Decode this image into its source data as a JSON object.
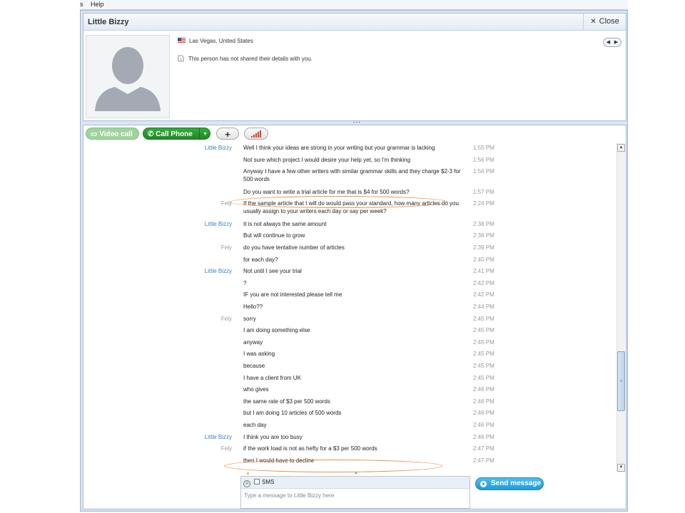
{
  "menu": {
    "partial_item": "s",
    "help": "Help"
  },
  "profile": {
    "name": "Little Bizzy",
    "close_label": "Close",
    "location": "Las Vegas, United States",
    "notice": "This person has not shared their details with you."
  },
  "toolbar": {
    "video_label": "Video call",
    "call_label": "Call Phone",
    "add_label": "+"
  },
  "messages": [
    {
      "sender": "Little Bizzy",
      "text": "Well I think your ideas are strong in your writing but your grammar is lacking",
      "time": "1:55 PM"
    },
    {
      "sender": "",
      "text": "Not sure which project I would desire your help yet, so I'm thinking",
      "time": "1:56 PM"
    },
    {
      "sender": "",
      "text": "Anyway I have a few other writers with similar grammar skills and they charge $2-3 for 500 words",
      "time": "1:56 PM"
    },
    {
      "sender": "",
      "text": "Do you want to write a trial article for me that is $4 for 500 words?",
      "time": "1:57 PM"
    },
    {
      "sender": "Fely",
      "text": "If the sample article that I will do would pass your standard, how many articles do you usually assign to your writers each day or say per week?",
      "time": "2:24 PM"
    },
    {
      "sender": "Little Bizzy",
      "text": "It is not always the same amount",
      "time": "2:38 PM"
    },
    {
      "sender": "",
      "text": "But will continue to grow",
      "time": "2:38 PM"
    },
    {
      "sender": "Fely",
      "text": "do you have tentative number of articles",
      "time": "2:39 PM"
    },
    {
      "sender": "",
      "text": "for each day?",
      "time": "2:40 PM"
    },
    {
      "sender": "Little Bizzy",
      "text": "Not until I see your trial",
      "time": "2:41 PM"
    },
    {
      "sender": "",
      "text": "?",
      "time": "2:42 PM"
    },
    {
      "sender": "",
      "text": "IF you are not interested please tell me",
      "time": "2:42 PM"
    },
    {
      "sender": "",
      "text": "Hello??",
      "time": "2:44 PM"
    },
    {
      "sender": "Fely",
      "text": "sorry",
      "time": "2:45 PM"
    },
    {
      "sender": "",
      "text": "I am doing something else",
      "time": "2:45 PM"
    },
    {
      "sender": "",
      "text": "anyway",
      "time": "2:45 PM"
    },
    {
      "sender": "",
      "text": "I was asking",
      "time": "2:45 PM"
    },
    {
      "sender": "",
      "text": "because",
      "time": "2:45 PM"
    },
    {
      "sender": "",
      "text": "I have a client from UK",
      "time": "2:45 PM"
    },
    {
      "sender": "",
      "text": "who gives",
      "time": "2:46 PM"
    },
    {
      "sender": "",
      "text": "the same rate of $3 per 500 words",
      "time": "2:46 PM"
    },
    {
      "sender": "",
      "text": "but I am doing 10 articles of 500 words",
      "time": "2:46 PM"
    },
    {
      "sender": "",
      "text": "each day",
      "time": "2:46 PM"
    },
    {
      "sender": "Little Bizzy",
      "text": "I think you are too busy",
      "time": "2:46 PM"
    },
    {
      "sender": "Fely",
      "text": "if the work load is not as hefty for a $3 per 500 words",
      "time": "2:47 PM"
    },
    {
      "sender": "",
      "text": "then I would have to decline",
      "time": "2:47 PM"
    }
  ],
  "compose": {
    "sms_label": "SMS",
    "placeholder": "Type a message to Little Bizzy here",
    "send_label": "Send message"
  },
  "colors": {
    "sender_little_bizzy": "#3b7fc4",
    "sender_fely": "#999999",
    "call_green": "#1f8a25",
    "send_blue": "#1f9ad8",
    "highlight_orange": "#e8914a"
  }
}
